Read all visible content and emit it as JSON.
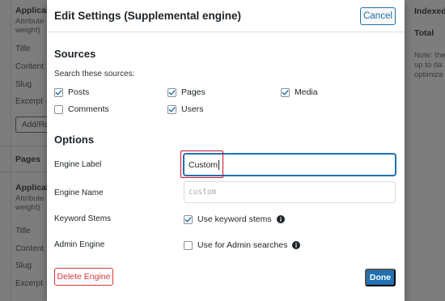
{
  "background": {
    "left": {
      "applicable_heading": "Applicab",
      "attribute_text": "Attribute weight)",
      "attribute_line1": "Attribute",
      "attribute_line2": "weight)",
      "items_top": [
        "Title",
        "Content",
        "Slug",
        "Excerpt"
      ],
      "add_button": "Add/Re",
      "pages_heading": "Pages",
      "applicable_heading_2": "Applicab",
      "attribute_line1_2": "Attribute",
      "attribute_line2_2": "weight)",
      "items_bottom": [
        "Title",
        "Content",
        "Slug",
        "Excerpt"
      ]
    },
    "right": {
      "indexed": "Indexed",
      "total": "Total",
      "note_line1": "Note: the",
      "note_line2": "up to da",
      "note_line3": "optimiza"
    }
  },
  "modal": {
    "title": "Edit Settings (Supplemental engine)",
    "cancel_label": "Cancel",
    "sources": {
      "heading": "Sources",
      "subtitle": "Search these sources:",
      "items": [
        {
          "label": "Posts",
          "checked": true
        },
        {
          "label": "Pages",
          "checked": true
        },
        {
          "label": "Media",
          "checked": true
        },
        {
          "label": "Comments",
          "checked": false
        },
        {
          "label": "Users",
          "checked": true
        }
      ]
    },
    "options": {
      "heading": "Options",
      "engine_label": {
        "label": "Engine Label",
        "value": "Custom"
      },
      "engine_name": {
        "label": "Engine Name",
        "placeholder": "custom"
      },
      "keyword_stems": {
        "label": "Keyword Stems",
        "checkbox_label": "Use keyword stems",
        "checked": true
      },
      "admin_engine": {
        "label": "Admin Engine",
        "checkbox_label": "Use for Admin searches",
        "checked": false
      }
    },
    "delete_label": "Delete Engine",
    "done_label": "Done"
  },
  "colors": {
    "accent": "#2271b1",
    "danger": "#d63638",
    "highlight": "#c8102e",
    "overlay": "#7d7d7d"
  }
}
